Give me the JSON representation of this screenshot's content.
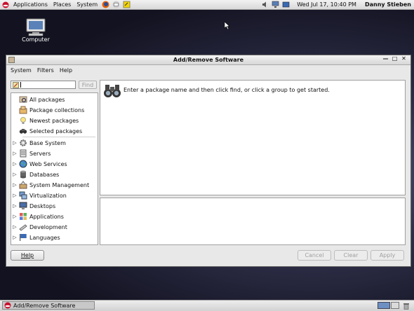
{
  "top_panel": {
    "menus": [
      "Applications",
      "Places",
      "System"
    ],
    "clock": "Wed Jul 17, 10:40 PM",
    "user": "Danny Stieben"
  },
  "desktop": {
    "computer_label": "Computer"
  },
  "window": {
    "title": "Add/Remove Software",
    "menu": [
      "System",
      "Filters",
      "Help"
    ],
    "search": {
      "value": "",
      "find_label": "Find"
    },
    "nav": [
      {
        "label": "All packages",
        "icon": "all-packages-icon"
      },
      {
        "label": "Package collections",
        "icon": "package-collections-icon"
      },
      {
        "label": "Newest packages",
        "icon": "newest-packages-icon"
      },
      {
        "label": "Selected packages",
        "icon": "selected-packages-icon"
      }
    ],
    "groups": [
      {
        "label": "Base System",
        "icon": "base-system-icon"
      },
      {
        "label": "Servers",
        "icon": "servers-icon"
      },
      {
        "label": "Web Services",
        "icon": "web-services-icon"
      },
      {
        "label": "Databases",
        "icon": "databases-icon"
      },
      {
        "label": "System Management",
        "icon": "system-management-icon"
      },
      {
        "label": "Virtualization",
        "icon": "virtualization-icon"
      },
      {
        "label": "Desktops",
        "icon": "desktops-icon"
      },
      {
        "label": "Applications",
        "icon": "applications-icon"
      },
      {
        "label": "Development",
        "icon": "development-icon"
      },
      {
        "label": "Languages",
        "icon": "languages-icon"
      }
    ],
    "hint": "Enter a package name and then click find, or click a group to get started.",
    "buttons": {
      "help": "Help",
      "cancel": "Cancel",
      "clear": "Clear",
      "apply": "Apply"
    }
  },
  "taskbar": {
    "task_label": "Add/Remove Software"
  }
}
